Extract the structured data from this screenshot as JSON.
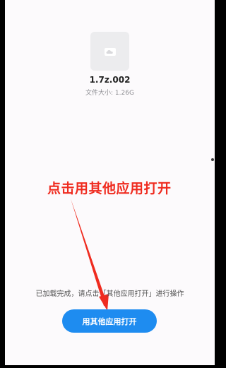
{
  "file": {
    "name": "1.7z.002",
    "size_text": "文件大小: 1.26G",
    "icon": "cloud-file-icon"
  },
  "annotation": {
    "text": "点击用其他应用打开",
    "color": "#ef2b1f"
  },
  "status": {
    "text": "已加载完成，请点击「其他应用打开」进行操作"
  },
  "actions": {
    "open_with_other_app_label": "用其他应用打开"
  },
  "colors": {
    "accent": "#1e8cf0",
    "background": "#fcfafc"
  }
}
